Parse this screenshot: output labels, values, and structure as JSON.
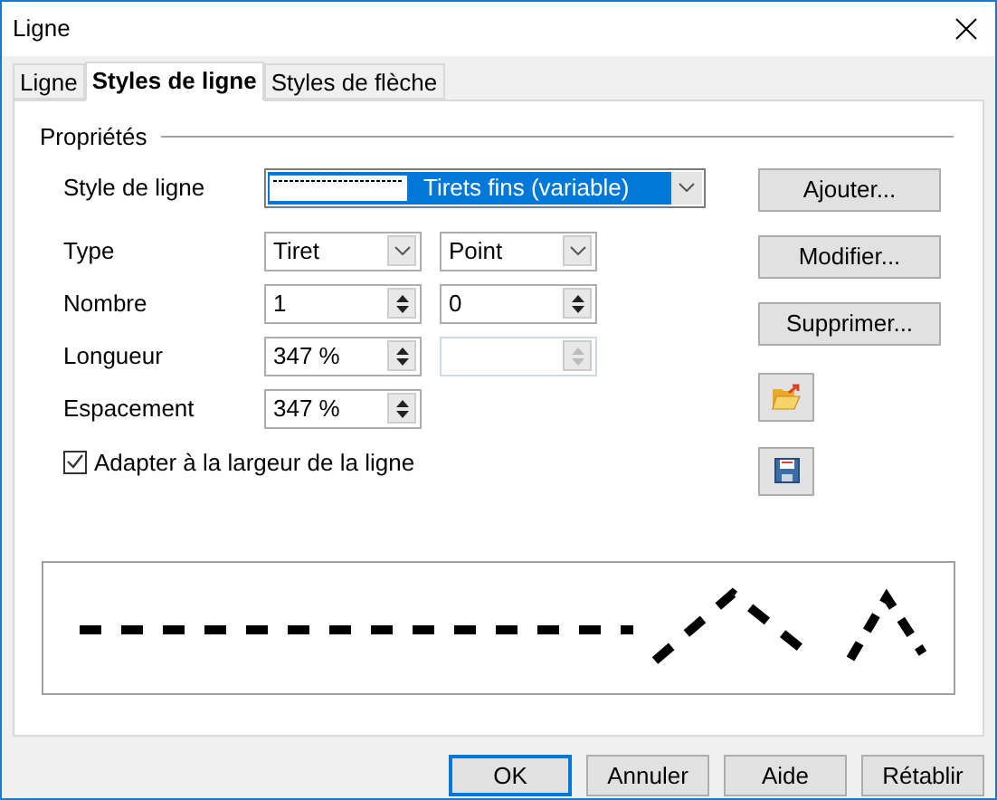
{
  "window": {
    "title": "Ligne"
  },
  "tabs": [
    {
      "label": "Ligne",
      "selected": false
    },
    {
      "label": "Styles de ligne",
      "selected": true
    },
    {
      "label": "Styles de flèche",
      "selected": false
    }
  ],
  "group_title": "Propriétés",
  "line_style": {
    "label": "Style de ligne",
    "value": "Tirets fins (variable)"
  },
  "type": {
    "label": "Type",
    "values": [
      "Tiret",
      "Point"
    ]
  },
  "rows": [
    {
      "label": "Nombre",
      "fields": [
        {
          "value": "1",
          "disabled": false
        },
        {
          "value": "0",
          "disabled": false
        }
      ]
    },
    {
      "label": "Longueur",
      "fields": [
        {
          "value": "347 %",
          "disabled": false
        },
        {
          "disabled": true
        }
      ]
    },
    {
      "label": "Espacement",
      "fields": [
        {
          "value": "347 %",
          "disabled": false
        }
      ]
    }
  ],
  "fit_width": {
    "label": "Adapter à la largeur de la ligne",
    "checked": true
  },
  "side_buttons": [
    "Ajouter...",
    "Modifier...",
    "Supprimer..."
  ],
  "footer_buttons": [
    {
      "label": "OK",
      "default": true
    },
    {
      "label": "Annuler",
      "default": false
    },
    {
      "label": "Aide",
      "default": false
    },
    {
      "label": "Rétablir",
      "default": false
    }
  ]
}
